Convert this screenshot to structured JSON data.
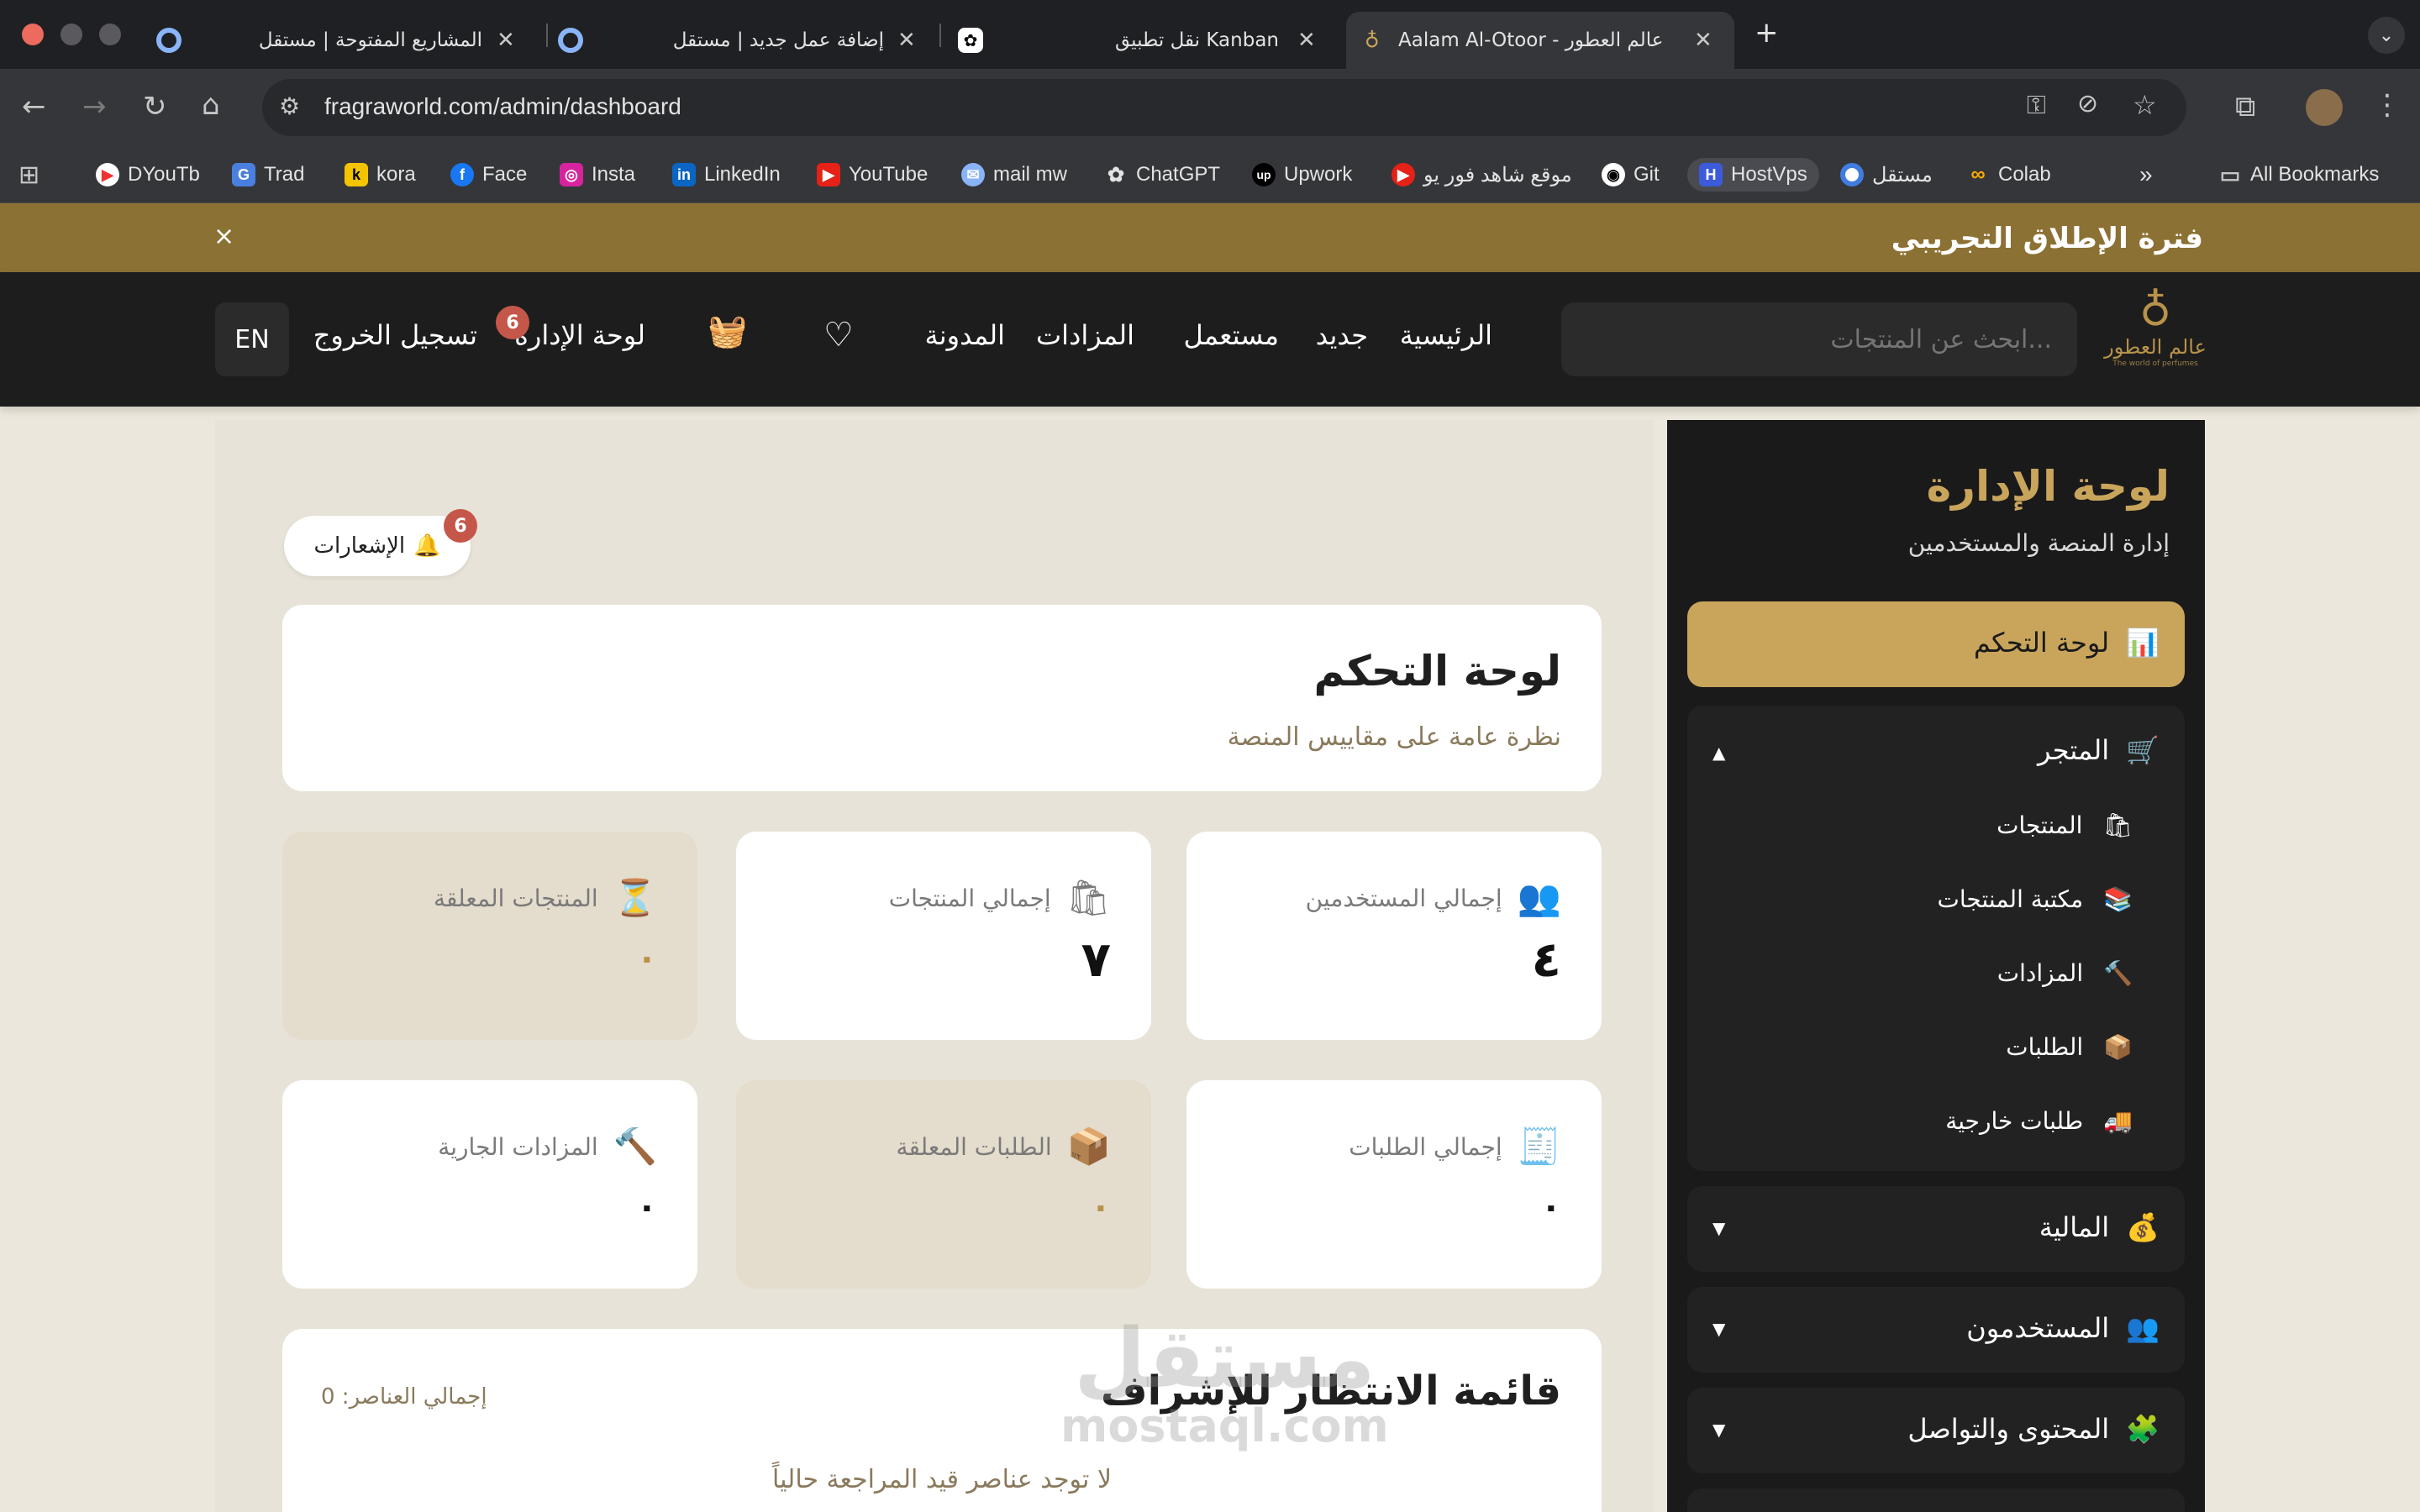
{
  "browser": {
    "tabs": [
      {
        "title": "المشاريع المفتوحة | مستقل"
      },
      {
        "title": "إضافة عمل جديد | مستقل"
      },
      {
        "title": "نقل تطبيق Kanban"
      },
      {
        "title": "Aalam Al-Otoor - عالم العطور"
      }
    ],
    "url": "fragraworld.com/admin/dashboard",
    "bookmarks": [
      "DYouTb",
      "Trad",
      "kora",
      "Face",
      "Insta",
      "LinkedIn",
      "YouTube",
      "mail mw",
      "ChatGPT",
      "Upwork",
      "موقع شاهد فور يو",
      "Git",
      "HostVps",
      "مستقل",
      "Colab"
    ],
    "all_bookmarks": "All Bookmarks"
  },
  "banner": {
    "text": "فترة الإطلاق التجريبي",
    "close": "×"
  },
  "header": {
    "logo_text": "عالم العطور",
    "logo_sub": "The world of perfumes",
    "search_placeholder": "ابحث عن المنتجات...",
    "nav": [
      "الرئيسية",
      "جديد",
      "مستعمل",
      "المزادات",
      "المدونة"
    ],
    "admin_label": "لوحة الإدارة",
    "admin_badge": "6",
    "logout": "تسجيل الخروج",
    "lang": "EN"
  },
  "sidebar": {
    "title": "لوحة الإدارة",
    "subtitle": "إدارة المنصة والمستخدمين",
    "active_item": "لوحة التحكم",
    "store": {
      "label": "المتجر",
      "items": [
        "المنتجات",
        "مكتبة المنتجات",
        "المزادات",
        "الطلبات",
        "طلبات خارجية"
      ]
    },
    "groups": [
      "المالية",
      "المستخدمون",
      "المحتوى والتواصل"
    ]
  },
  "main": {
    "notifications_label": "الإشعارات",
    "notifications_badge": "6",
    "title": "لوحة التحكم",
    "subtitle": "نظرة عامة على مقاييس المنصة",
    "stats": [
      {
        "label": "إجمالي المستخدمين",
        "value": "٤"
      },
      {
        "label": "إجمالي المنتجات",
        "value": "٧"
      },
      {
        "label": "المنتجات المعلقة",
        "value": "٠"
      },
      {
        "label": "إجمالي الطلبات",
        "value": "٠"
      },
      {
        "label": "الطلبات المعلقة",
        "value": "٠"
      },
      {
        "label": "المزادات الجارية",
        "value": "٠"
      }
    ],
    "queue": {
      "title": "قائمة الانتظار للإشراف",
      "total": "إجمالي العناصر: 0",
      "empty": "لا توجد عناصر قيد المراجعة حالياً"
    }
  },
  "watermark": {
    "line1": "مستقل",
    "line2": "mostaql.com"
  },
  "colors": {
    "gold": "#c9a55c",
    "banner": "#8c7134",
    "header": "#1d1d1d",
    "badge": "#c5574a"
  }
}
